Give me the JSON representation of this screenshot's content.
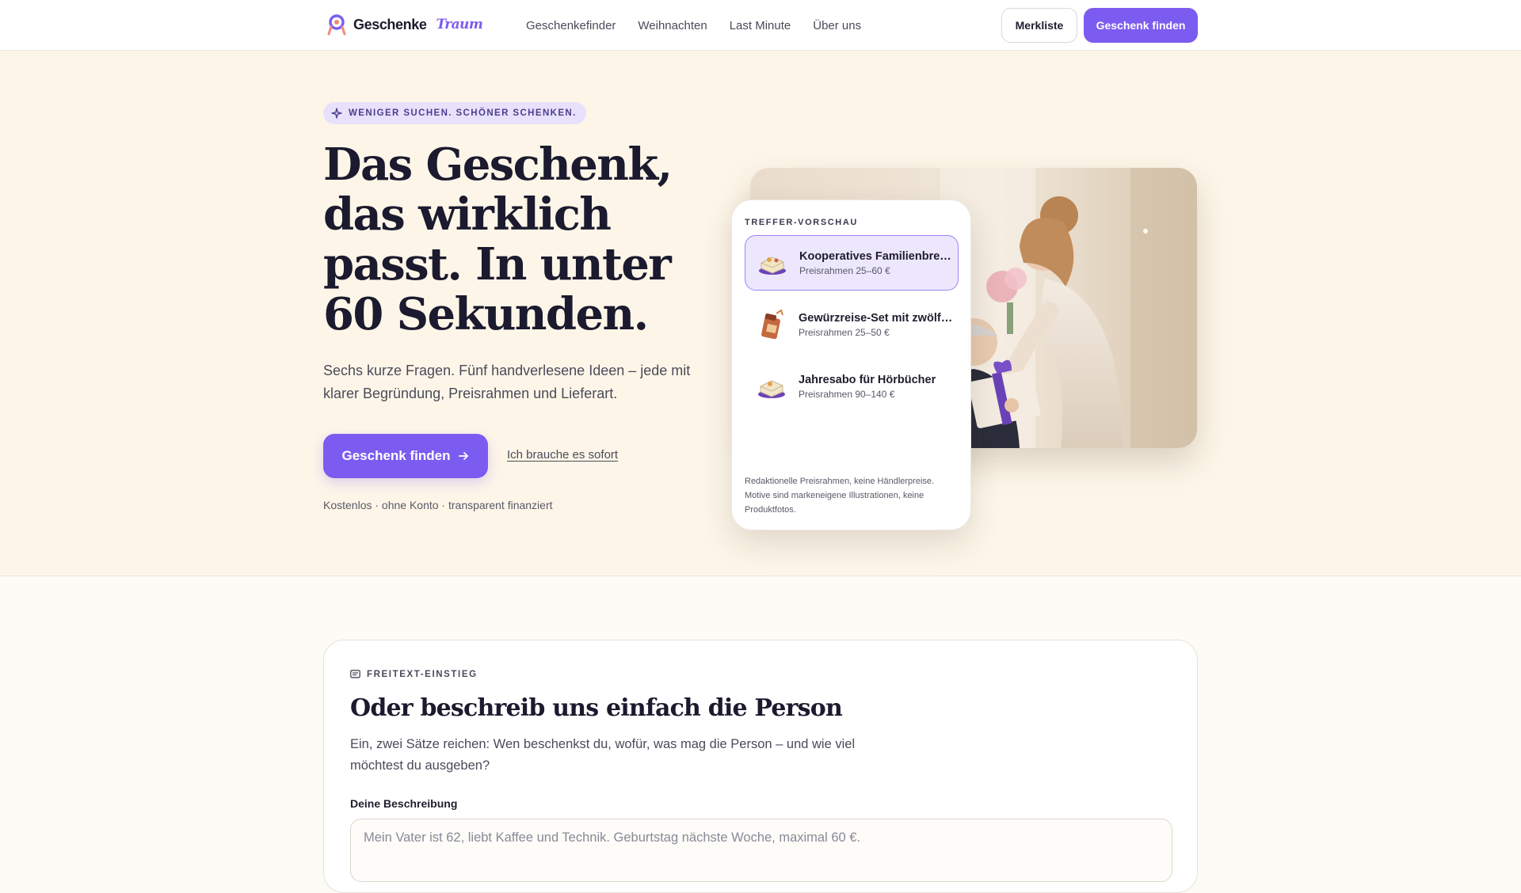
{
  "brand": {
    "name": "Geschenke",
    "accent": "Traum"
  },
  "nav": [
    "Geschenkefinder",
    "Weihnachten",
    "Last Minute",
    "Über uns"
  ],
  "header_buttons": {
    "wishlist": "Merkliste",
    "primary": "Geschenk finden"
  },
  "hero": {
    "eyebrow": "WENIGER SUCHEN. SCHÖNER SCHENKEN.",
    "headline": "Das Geschenk, das wirklich passt. In unter 60 Sekunden.",
    "lead": "Sechs kurze Fragen. Fünf handverlesene Ideen – jede mit klarer Begründung, Preisrahmen und Lieferart.",
    "cta": "Geschenk finden",
    "secondary_link": "Ich brauche es sofort",
    "fineprint": "Kostenlos · ohne Konto · transparent finanziert"
  },
  "preview": {
    "title": "TREFFER-VORSCHAU",
    "items": [
      {
        "name": "Kooperatives Familienbrettspiel",
        "price": "Preisrahmen 25–60 €",
        "icon": "board-game-icon"
      },
      {
        "name": "Gewürzreise-Set mit zwölf Sorten",
        "price": "Preisrahmen 25–50 €",
        "icon": "spice-set-icon"
      },
      {
        "name": "Jahresabo für Hörbücher",
        "price": "Preisrahmen 90–140 €",
        "icon": "audiobook-icon"
      }
    ],
    "note": "Redaktionelle Preisrahmen, keine Händlerpreise. Motive sind markeneigene Illustrationen, keine Produktfotos."
  },
  "freetext": {
    "kicker": "FREITEXT-EINSTIEG",
    "title": "Oder beschreib uns einfach die Person",
    "text": "Ein, zwei Sätze reichen: Wen beschenkst du, wofür, was mag die Person – und wie viel möchtest du ausgeben?",
    "label": "Deine Beschreibung",
    "placeholder": "Mein Vater ist 62, liebt Kaffee und Technik. Geburtstag nächste Woche, maximal 60 €."
  },
  "colors": {
    "accent": "#7c5cf0",
    "hero_bg": "#fdf6e8",
    "ink": "#1b1a2e"
  }
}
